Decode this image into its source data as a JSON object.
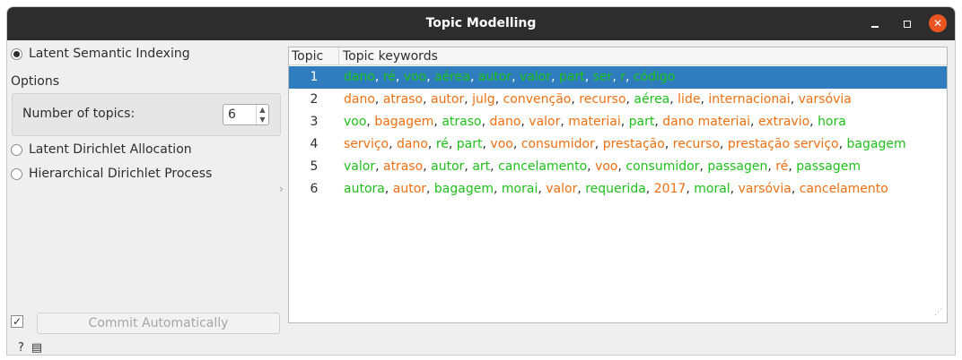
{
  "window": {
    "title": "Topic Modelling"
  },
  "methods": {
    "lsi": {
      "label": "Latent Semantic Indexing",
      "selected": true
    },
    "lda": {
      "label": "Latent Dirichlet Allocation",
      "selected": false
    },
    "hdp": {
      "label": "Hierarchical Dirichlet Process",
      "selected": false
    }
  },
  "options": {
    "section_label": "Options",
    "num_topics_label": "Number of topics:",
    "num_topics_value": "6"
  },
  "commit": {
    "checked": true,
    "label": "Commit Automatically"
  },
  "table": {
    "headers": [
      "Topic",
      "Topic keywords"
    ],
    "selected_row": 0,
    "rows": [
      {
        "topic": "1",
        "keywords": [
          {
            "w": "dano",
            "c": "g"
          },
          {
            "w": "ré",
            "c": "g"
          },
          {
            "w": "voo",
            "c": "g"
          },
          {
            "w": "aérea",
            "c": "g"
          },
          {
            "w": "autor",
            "c": "g"
          },
          {
            "w": "valor",
            "c": "g"
          },
          {
            "w": "part",
            "c": "g"
          },
          {
            "w": "ser",
            "c": "g"
          },
          {
            "w": "r",
            "c": "g"
          },
          {
            "w": "código",
            "c": "g"
          }
        ]
      },
      {
        "topic": "2",
        "keywords": [
          {
            "w": "dano",
            "c": "o"
          },
          {
            "w": "atraso",
            "c": "o"
          },
          {
            "w": "autor",
            "c": "o"
          },
          {
            "w": "julg",
            "c": "o"
          },
          {
            "w": "convenção",
            "c": "o"
          },
          {
            "w": "recurso",
            "c": "o"
          },
          {
            "w": "aérea",
            "c": "g"
          },
          {
            "w": "lide",
            "c": "o"
          },
          {
            "w": "internacionai",
            "c": "o"
          },
          {
            "w": "varsóvia",
            "c": "o"
          }
        ]
      },
      {
        "topic": "3",
        "keywords": [
          {
            "w": "voo",
            "c": "g"
          },
          {
            "w": "bagagem",
            "c": "o"
          },
          {
            "w": "atraso",
            "c": "g"
          },
          {
            "w": "dano",
            "c": "o"
          },
          {
            "w": "valor",
            "c": "o"
          },
          {
            "w": "materiai",
            "c": "o"
          },
          {
            "w": "part",
            "c": "g"
          },
          {
            "w": "dano materiai",
            "c": "o"
          },
          {
            "w": "extravio",
            "c": "o"
          },
          {
            "w": "hora",
            "c": "g"
          }
        ]
      },
      {
        "topic": "4",
        "keywords": [
          {
            "w": "serviço",
            "c": "o"
          },
          {
            "w": "dano",
            "c": "o"
          },
          {
            "w": "ré",
            "c": "g"
          },
          {
            "w": "part",
            "c": "g"
          },
          {
            "w": "voo",
            "c": "o"
          },
          {
            "w": "consumidor",
            "c": "o"
          },
          {
            "w": "prestação",
            "c": "o"
          },
          {
            "w": "recurso",
            "c": "o"
          },
          {
            "w": "prestação serviço",
            "c": "o"
          },
          {
            "w": "bagagem",
            "c": "g"
          }
        ]
      },
      {
        "topic": "5",
        "keywords": [
          {
            "w": "valor",
            "c": "g"
          },
          {
            "w": "atraso",
            "c": "o"
          },
          {
            "w": "autor",
            "c": "g"
          },
          {
            "w": "art",
            "c": "g"
          },
          {
            "w": "cancelamento",
            "c": "g"
          },
          {
            "w": "voo",
            "c": "o"
          },
          {
            "w": "consumidor",
            "c": "g"
          },
          {
            "w": "passagen",
            "c": "g"
          },
          {
            "w": "ré",
            "c": "o"
          },
          {
            "w": "passagem",
            "c": "g"
          }
        ]
      },
      {
        "topic": "6",
        "keywords": [
          {
            "w": "autora",
            "c": "g"
          },
          {
            "w": "autor",
            "c": "o"
          },
          {
            "w": "bagagem",
            "c": "g"
          },
          {
            "w": "morai",
            "c": "g"
          },
          {
            "w": "valor",
            "c": "o"
          },
          {
            "w": "requerida",
            "c": "g"
          },
          {
            "w": "2017",
            "c": "o"
          },
          {
            "w": "moral",
            "c": "g"
          },
          {
            "w": "varsóvia",
            "c": "o"
          },
          {
            "w": "cancelamento",
            "c": "o"
          }
        ]
      }
    ]
  },
  "colors": {
    "positive": "#1ec01a",
    "negative": "#ef6f11",
    "selection": "#2f7dbf",
    "close_button": "#e95420"
  },
  "icons": {
    "help": "help-icon",
    "report": "report-icon"
  }
}
